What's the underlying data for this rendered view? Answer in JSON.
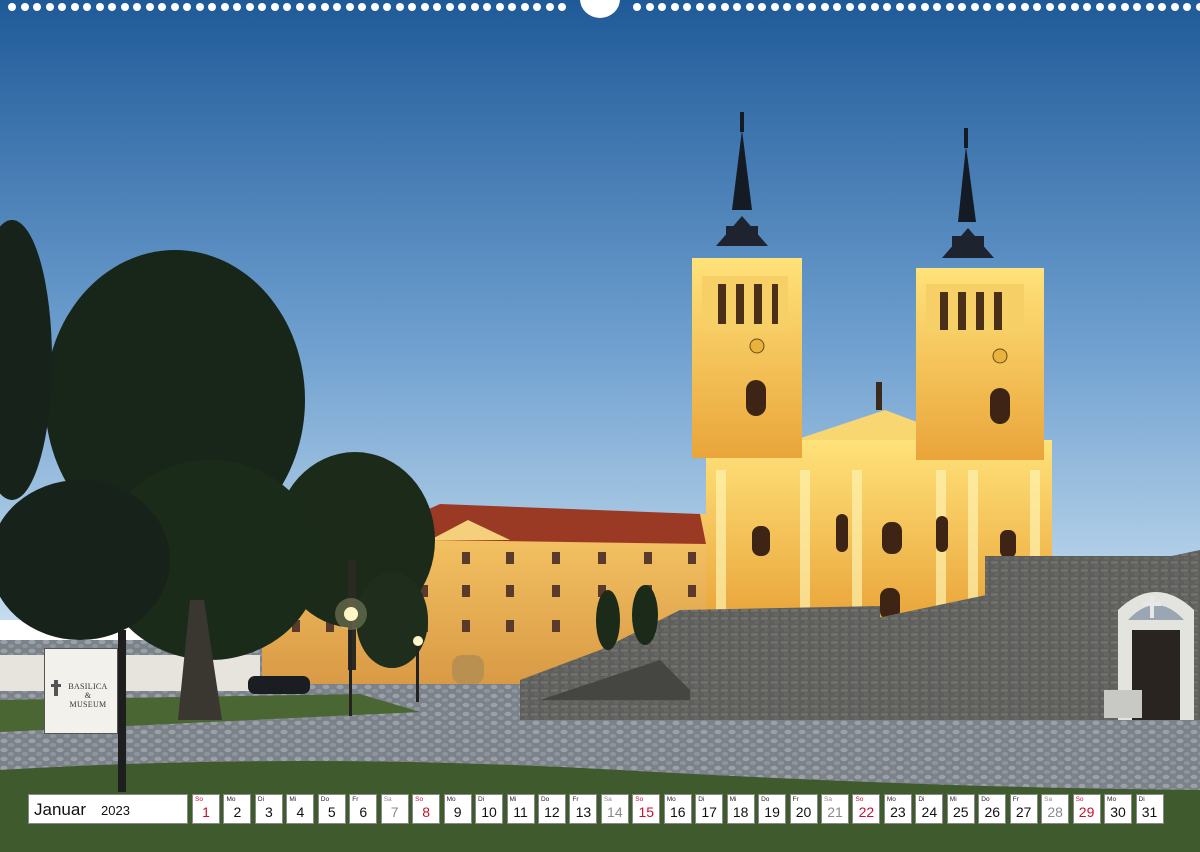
{
  "calendar": {
    "month": "Januar",
    "year": "2023",
    "days": [
      {
        "wd": "So",
        "d": "1",
        "type": "sun"
      },
      {
        "wd": "Mo",
        "d": "2",
        "type": "week"
      },
      {
        "wd": "Di",
        "d": "3",
        "type": "week"
      },
      {
        "wd": "Mi",
        "d": "4",
        "type": "week"
      },
      {
        "wd": "Do",
        "d": "5",
        "type": "week"
      },
      {
        "wd": "Fr",
        "d": "6",
        "type": "week"
      },
      {
        "wd": "Sa",
        "d": "7",
        "type": "sat"
      },
      {
        "wd": "So",
        "d": "8",
        "type": "sun"
      },
      {
        "wd": "Mo",
        "d": "9",
        "type": "week"
      },
      {
        "wd": "Di",
        "d": "10",
        "type": "week"
      },
      {
        "wd": "Mi",
        "d": "11",
        "type": "week"
      },
      {
        "wd": "Do",
        "d": "12",
        "type": "week"
      },
      {
        "wd": "Fr",
        "d": "13",
        "type": "week"
      },
      {
        "wd": "Sa",
        "d": "14",
        "type": "sat"
      },
      {
        "wd": "So",
        "d": "15",
        "type": "sun"
      },
      {
        "wd": "Mo",
        "d": "16",
        "type": "week"
      },
      {
        "wd": "Di",
        "d": "17",
        "type": "week"
      },
      {
        "wd": "Mi",
        "d": "18",
        "type": "week"
      },
      {
        "wd": "Do",
        "d": "19",
        "type": "week"
      },
      {
        "wd": "Fr",
        "d": "20",
        "type": "week"
      },
      {
        "wd": "Sa",
        "d": "21",
        "type": "sat"
      },
      {
        "wd": "So",
        "d": "22",
        "type": "sun"
      },
      {
        "wd": "Mo",
        "d": "23",
        "type": "week"
      },
      {
        "wd": "Di",
        "d": "24",
        "type": "week"
      },
      {
        "wd": "Mi",
        "d": "25",
        "type": "week"
      },
      {
        "wd": "Do",
        "d": "26",
        "type": "week"
      },
      {
        "wd": "Fr",
        "d": "27",
        "type": "week"
      },
      {
        "wd": "Sa",
        "d": "28",
        "type": "sat"
      },
      {
        "wd": "So",
        "d": "29",
        "type": "sun"
      },
      {
        "wd": "Mo",
        "d": "30",
        "type": "week"
      },
      {
        "wd": "Di",
        "d": "31",
        "type": "week"
      }
    ]
  },
  "sign": {
    "line1": "BASILICA",
    "line2": "&",
    "line3": "MUSEUM"
  },
  "colors": {
    "sky_top": "#1f5a98",
    "sky_bottom": "#b9d4ec",
    "facade": "#f3c64a",
    "sunday": "#c8102e",
    "saturday": "#8a8a8a"
  }
}
